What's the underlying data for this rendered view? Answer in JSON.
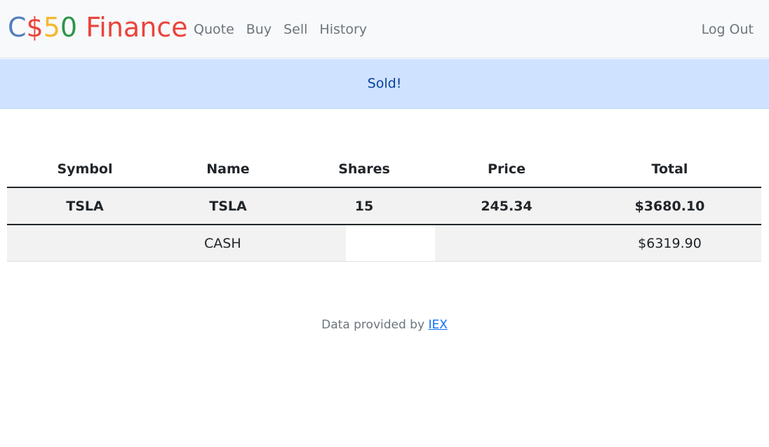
{
  "nav": {
    "brand": {
      "parts": [
        {
          "text": "C",
          "color": "#537fbe"
        },
        {
          "text": "$",
          "color": "#ea433b"
        },
        {
          "text": "5",
          "color": "#f5b82e"
        },
        {
          "text": "0",
          "color": "#2e944b"
        },
        {
          "text": " Finance",
          "color": "#ea433b"
        }
      ]
    },
    "links": [
      "Quote",
      "Buy",
      "Sell",
      "History"
    ],
    "logout": "Log Out"
  },
  "alert": {
    "message": "Sold!"
  },
  "table": {
    "headers": [
      "Symbol",
      "Name",
      "Shares",
      "Price",
      "Total"
    ],
    "rows": [
      {
        "symbol": "TSLA",
        "name": "TSLA",
        "shares": "15",
        "price": "245.34",
        "total": "$3680.10"
      }
    ],
    "cash_label": "CASH",
    "cash_value": "$6319.90"
  },
  "footer": {
    "prefix": "Data provided by ",
    "link_text": "IEX"
  }
}
